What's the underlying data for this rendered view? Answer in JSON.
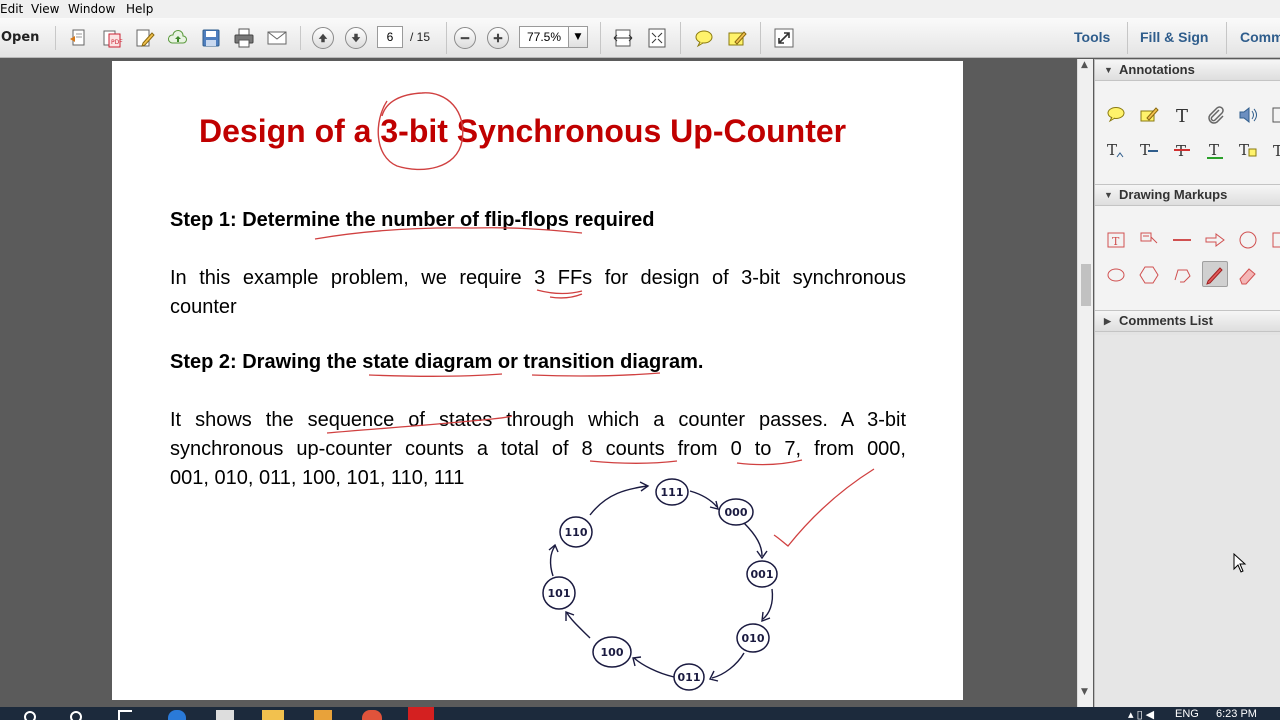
{
  "menu": {
    "items": [
      "Edit",
      "View",
      "Window",
      "Help"
    ]
  },
  "toolbar": {
    "open_label": "Open",
    "page_current": "6",
    "page_total": "/ 15",
    "zoom": "77.5%",
    "links": [
      "Tools",
      "Fill & Sign",
      "Comm"
    ]
  },
  "document": {
    "title": "Design of a 3-bit Synchronous Up-Counter",
    "step1": "Step 1: Determine the number of flip-flops required",
    "para1": [
      "In this example problem, we require 3 FFs for design of 3-bit synchronous",
      "counter"
    ],
    "step2": "Step 2: Drawing the state diagram or transition diagram.",
    "para2": [
      "It shows the sequence of states through which a counter passes. A 3-bit",
      "synchronous up-counter counts  a total of 8 counts from 0 to 7, from 000,",
      "001, 010, 011, 100, 101, 110,  111"
    ],
    "states": [
      "111",
      "000",
      "001",
      "010",
      "011",
      "100",
      "101",
      "110"
    ]
  },
  "pane": {
    "annotations": "Annotations",
    "drawing_markups": "Drawing Markups",
    "comments_list": "Comments List"
  },
  "taskbar": {
    "lang": "ENG",
    "time": "6:23 PM"
  },
  "colors": {
    "title_red": "#c00000",
    "ink_red": "#d04040",
    "ink_blue": "#1a1a40",
    "link_blue": "#2f5d8c"
  }
}
